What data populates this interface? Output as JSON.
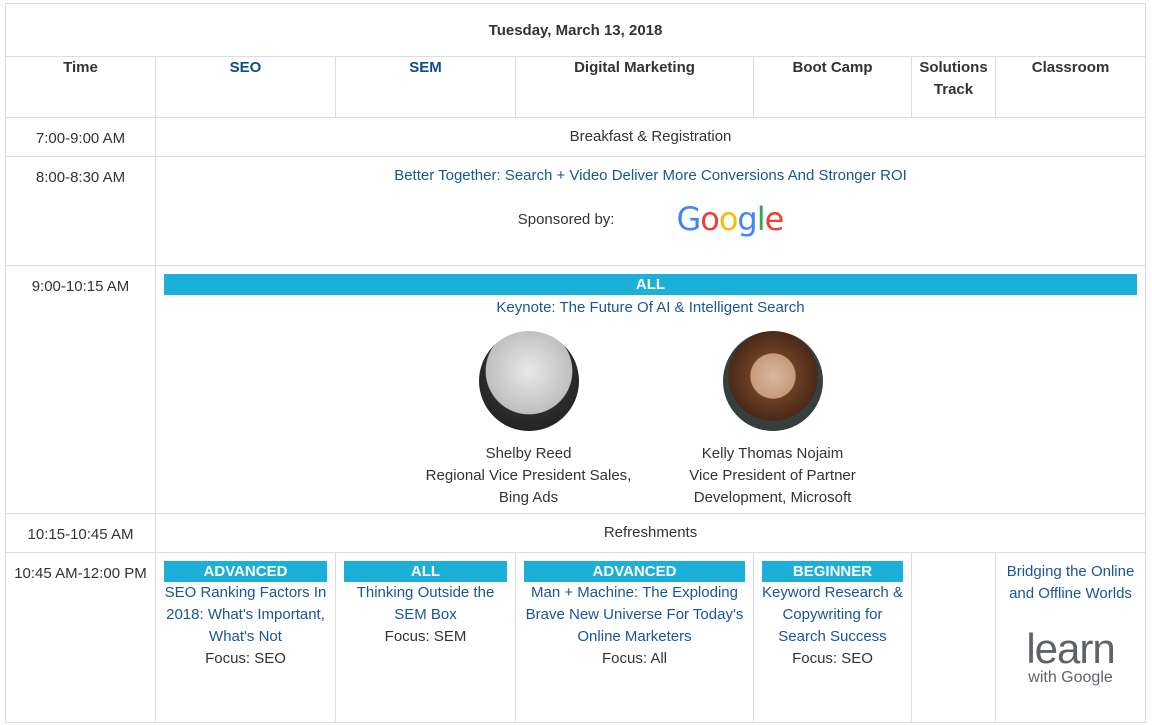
{
  "title": "Tuesday, March 13, 2018",
  "columns": {
    "time": "Time",
    "seo": "SEO",
    "sem": "SEM",
    "digital": "Digital Marketing",
    "bootcamp": "Boot Camp",
    "solutions": "Solutions Track",
    "classroom": "Classroom"
  },
  "rows": {
    "r1": {
      "time": "7:00-9:00 AM",
      "text": "Breakfast & Registration"
    },
    "r2": {
      "time": "8:00-8:30 AM",
      "session": "Better Together: Search + Video Deliver More Conversions And Stronger ROI",
      "sponsored_by": "Sponsored by:",
      "sponsor_logo": "Google"
    },
    "r3": {
      "time": "9:00-10:15 AM",
      "badge": "ALL",
      "session": "Keynote: The Future Of AI & Intelligent Search",
      "speakers": [
        {
          "name": "Shelby Reed",
          "title_line1": "Regional Vice President Sales,",
          "title_line2": "Bing Ads"
        },
        {
          "name": "Kelly Thomas Nojaim",
          "title_line1": "Vice President of Partner",
          "title_line2": "Development, Microsoft"
        }
      ]
    },
    "r4": {
      "time": "10:15-10:45 AM",
      "text": "Refreshments"
    },
    "r5": {
      "time": "10:45 AM-12:00 PM",
      "seo": {
        "badge": "ADVANCED",
        "session": "SEO Ranking Factors In 2018: What's Important, What's Not",
        "focus": "Focus: SEO"
      },
      "sem": {
        "badge": "ALL",
        "session": "Thinking Outside the SEM Box",
        "focus": "Focus: SEM"
      },
      "digital": {
        "badge": "ADVANCED",
        "session": "Man + Machine: The Exploding Brave New Universe For Today's Online Marketers",
        "focus": "Focus: All"
      },
      "bootcamp": {
        "badge": "BEGINNER",
        "session": "Keyword Research & Copywriting for Search Success",
        "focus": "Focus: SEO"
      },
      "classroom": {
        "session": "Bridging the Online and Offline Worlds",
        "logo_word": "learn",
        "logo_with": "with",
        "logo_google": "Google"
      }
    }
  },
  "colors": {
    "badge": "#1cafd7",
    "link": "#1a5690"
  },
  "icons": [
    "google-logo",
    "learn-with-google-logo"
  ]
}
